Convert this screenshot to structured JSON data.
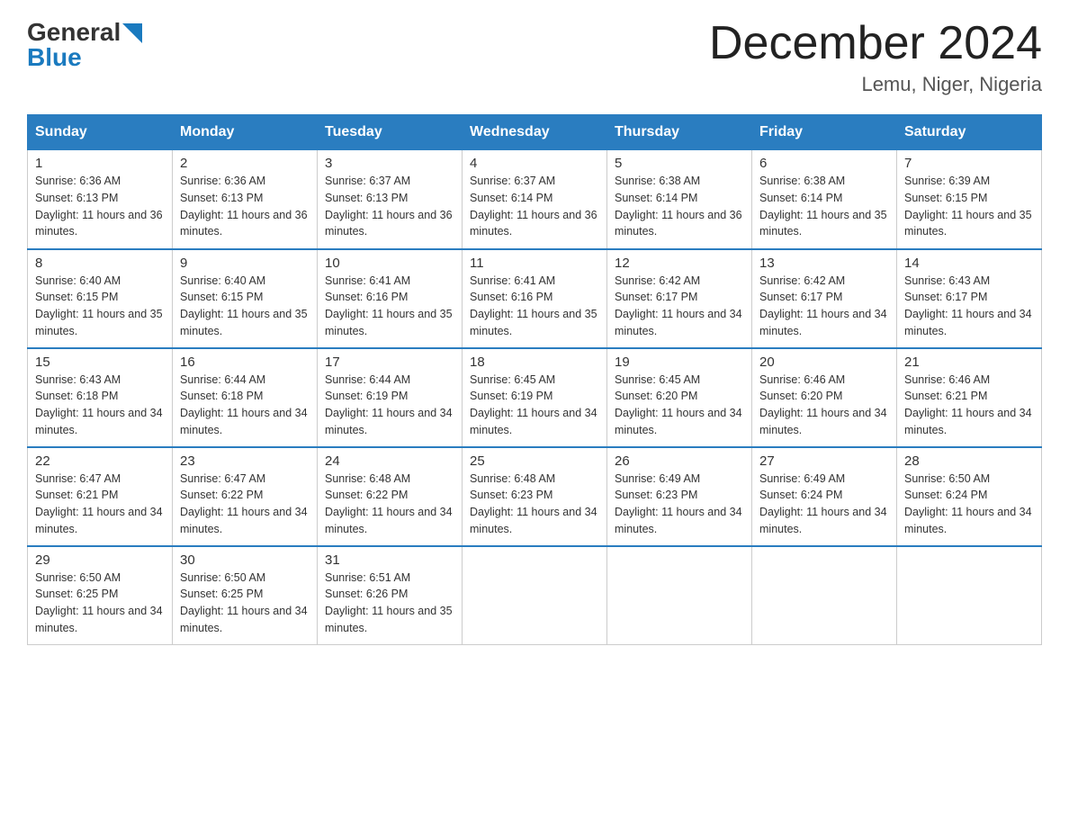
{
  "header": {
    "logo_general": "General",
    "logo_blue": "Blue",
    "month_title": "December 2024",
    "location": "Lemu, Niger, Nigeria"
  },
  "days_of_week": [
    "Sunday",
    "Monday",
    "Tuesday",
    "Wednesday",
    "Thursday",
    "Friday",
    "Saturday"
  ],
  "weeks": [
    [
      {
        "day": "1",
        "sunrise": "6:36 AM",
        "sunset": "6:13 PM",
        "daylight": "11 hours and 36 minutes."
      },
      {
        "day": "2",
        "sunrise": "6:36 AM",
        "sunset": "6:13 PM",
        "daylight": "11 hours and 36 minutes."
      },
      {
        "day": "3",
        "sunrise": "6:37 AM",
        "sunset": "6:13 PM",
        "daylight": "11 hours and 36 minutes."
      },
      {
        "day": "4",
        "sunrise": "6:37 AM",
        "sunset": "6:14 PM",
        "daylight": "11 hours and 36 minutes."
      },
      {
        "day": "5",
        "sunrise": "6:38 AM",
        "sunset": "6:14 PM",
        "daylight": "11 hours and 36 minutes."
      },
      {
        "day": "6",
        "sunrise": "6:38 AM",
        "sunset": "6:14 PM",
        "daylight": "11 hours and 35 minutes."
      },
      {
        "day": "7",
        "sunrise": "6:39 AM",
        "sunset": "6:15 PM",
        "daylight": "11 hours and 35 minutes."
      }
    ],
    [
      {
        "day": "8",
        "sunrise": "6:40 AM",
        "sunset": "6:15 PM",
        "daylight": "11 hours and 35 minutes."
      },
      {
        "day": "9",
        "sunrise": "6:40 AM",
        "sunset": "6:15 PM",
        "daylight": "11 hours and 35 minutes."
      },
      {
        "day": "10",
        "sunrise": "6:41 AM",
        "sunset": "6:16 PM",
        "daylight": "11 hours and 35 minutes."
      },
      {
        "day": "11",
        "sunrise": "6:41 AM",
        "sunset": "6:16 PM",
        "daylight": "11 hours and 35 minutes."
      },
      {
        "day": "12",
        "sunrise": "6:42 AM",
        "sunset": "6:17 PM",
        "daylight": "11 hours and 34 minutes."
      },
      {
        "day": "13",
        "sunrise": "6:42 AM",
        "sunset": "6:17 PM",
        "daylight": "11 hours and 34 minutes."
      },
      {
        "day": "14",
        "sunrise": "6:43 AM",
        "sunset": "6:17 PM",
        "daylight": "11 hours and 34 minutes."
      }
    ],
    [
      {
        "day": "15",
        "sunrise": "6:43 AM",
        "sunset": "6:18 PM",
        "daylight": "11 hours and 34 minutes."
      },
      {
        "day": "16",
        "sunrise": "6:44 AM",
        "sunset": "6:18 PM",
        "daylight": "11 hours and 34 minutes."
      },
      {
        "day": "17",
        "sunrise": "6:44 AM",
        "sunset": "6:19 PM",
        "daylight": "11 hours and 34 minutes."
      },
      {
        "day": "18",
        "sunrise": "6:45 AM",
        "sunset": "6:19 PM",
        "daylight": "11 hours and 34 minutes."
      },
      {
        "day": "19",
        "sunrise": "6:45 AM",
        "sunset": "6:20 PM",
        "daylight": "11 hours and 34 minutes."
      },
      {
        "day": "20",
        "sunrise": "6:46 AM",
        "sunset": "6:20 PM",
        "daylight": "11 hours and 34 minutes."
      },
      {
        "day": "21",
        "sunrise": "6:46 AM",
        "sunset": "6:21 PM",
        "daylight": "11 hours and 34 minutes."
      }
    ],
    [
      {
        "day": "22",
        "sunrise": "6:47 AM",
        "sunset": "6:21 PM",
        "daylight": "11 hours and 34 minutes."
      },
      {
        "day": "23",
        "sunrise": "6:47 AM",
        "sunset": "6:22 PM",
        "daylight": "11 hours and 34 minutes."
      },
      {
        "day": "24",
        "sunrise": "6:48 AM",
        "sunset": "6:22 PM",
        "daylight": "11 hours and 34 minutes."
      },
      {
        "day": "25",
        "sunrise": "6:48 AM",
        "sunset": "6:23 PM",
        "daylight": "11 hours and 34 minutes."
      },
      {
        "day": "26",
        "sunrise": "6:49 AM",
        "sunset": "6:23 PM",
        "daylight": "11 hours and 34 minutes."
      },
      {
        "day": "27",
        "sunrise": "6:49 AM",
        "sunset": "6:24 PM",
        "daylight": "11 hours and 34 minutes."
      },
      {
        "day": "28",
        "sunrise": "6:50 AM",
        "sunset": "6:24 PM",
        "daylight": "11 hours and 34 minutes."
      }
    ],
    [
      {
        "day": "29",
        "sunrise": "6:50 AM",
        "sunset": "6:25 PM",
        "daylight": "11 hours and 34 minutes."
      },
      {
        "day": "30",
        "sunrise": "6:50 AM",
        "sunset": "6:25 PM",
        "daylight": "11 hours and 34 minutes."
      },
      {
        "day": "31",
        "sunrise": "6:51 AM",
        "sunset": "6:26 PM",
        "daylight": "11 hours and 35 minutes."
      },
      null,
      null,
      null,
      null
    ]
  ],
  "labels": {
    "sunrise": "Sunrise: ",
    "sunset": "Sunset: ",
    "daylight": "Daylight: "
  }
}
